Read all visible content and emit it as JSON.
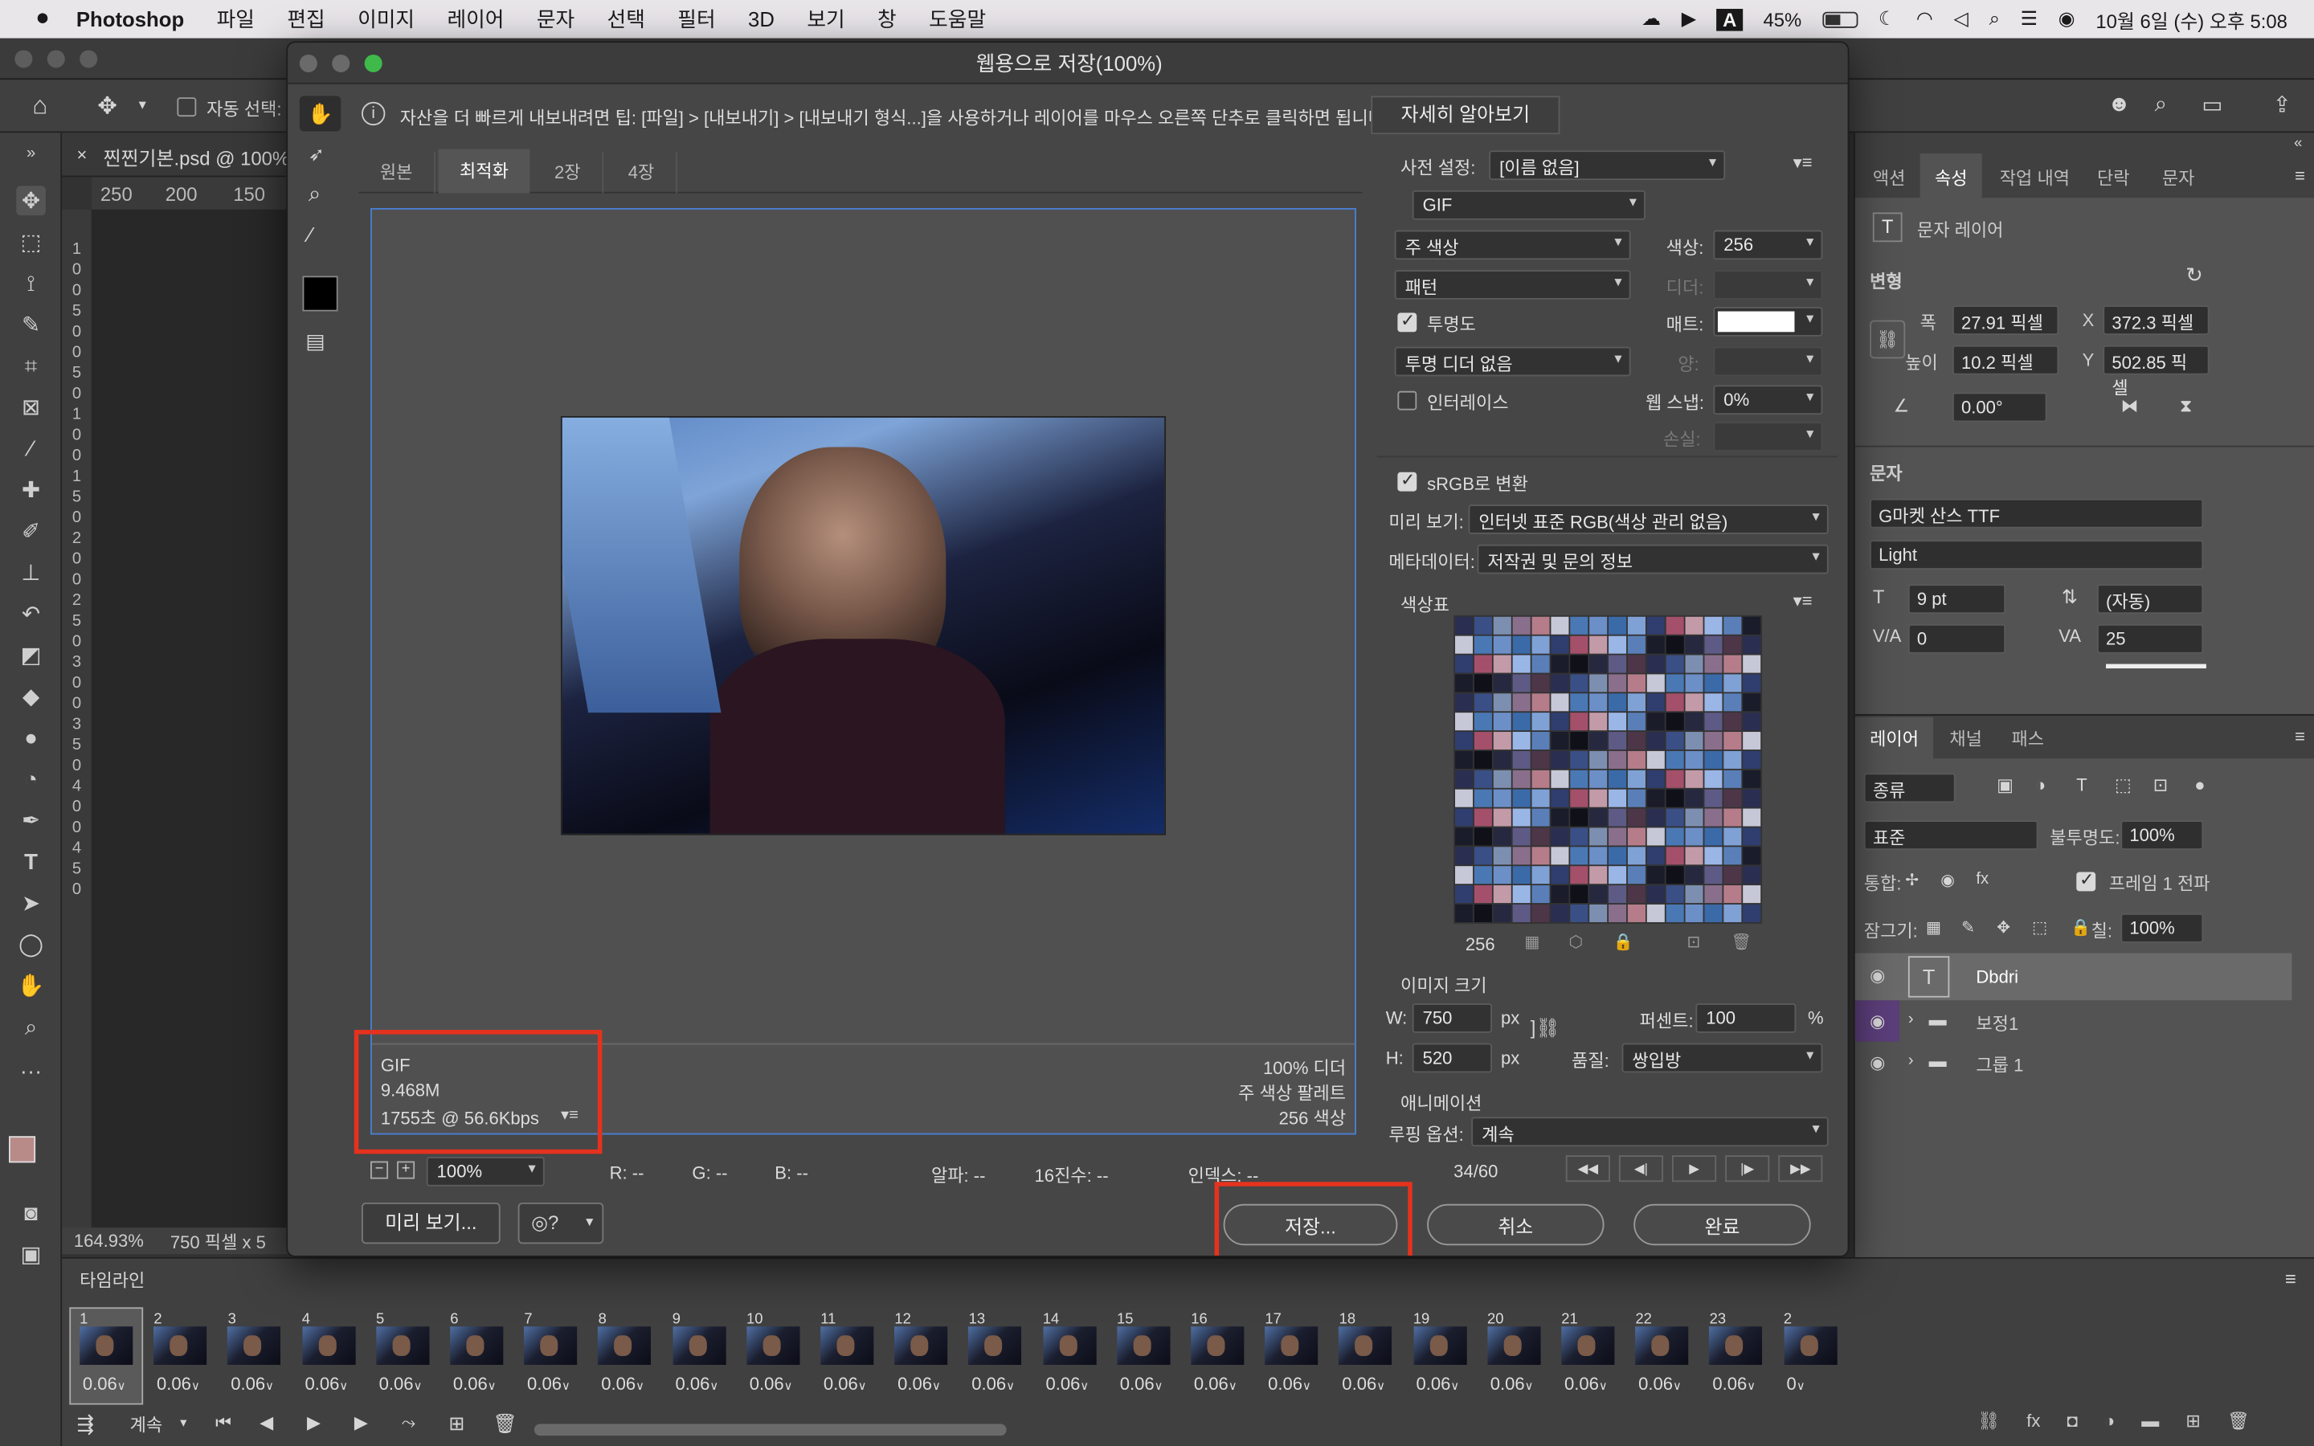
{
  "menubar": {
    "app_name": "Photoshop",
    "menus": [
      "파일",
      "편집",
      "이미지",
      "레이어",
      "문자",
      "선택",
      "필터",
      "3D",
      "보기",
      "창",
      "도움말"
    ],
    "battery": "45%",
    "datetime": "10월 6일 (수) 오후 5:08",
    "input_source": "A"
  },
  "optbar": {
    "auto_select_label": "자동 선택:"
  },
  "document": {
    "tab_title": "찐찐기본.psd @ 100%",
    "ruler_ticks": [
      "250",
      "200",
      "150"
    ],
    "ruler_v": "1 0 0 5 0 0 5 0 1 0 0 1 5 0 2 0 0 2 5 0 3 0 0 3 5 0 4 0 0 4 5 0",
    "zoom": "164.93%",
    "size_info": "750 픽셀 x 5"
  },
  "timeline": {
    "title": "타임라인",
    "frames": [
      {
        "n": "1",
        "d": "0.06"
      },
      {
        "n": "2",
        "d": "0.06"
      },
      {
        "n": "3",
        "d": "0.06"
      },
      {
        "n": "4",
        "d": "0.06"
      },
      {
        "n": "5",
        "d": "0.06"
      },
      {
        "n": "6",
        "d": "0.06"
      },
      {
        "n": "7",
        "d": "0.06"
      },
      {
        "n": "8",
        "d": "0.06"
      },
      {
        "n": "9",
        "d": "0.06"
      },
      {
        "n": "10",
        "d": "0.06"
      },
      {
        "n": "11",
        "d": "0.06"
      },
      {
        "n": "12",
        "d": "0.06"
      },
      {
        "n": "13",
        "d": "0.06"
      },
      {
        "n": "14",
        "d": "0.06"
      },
      {
        "n": "15",
        "d": "0.06"
      },
      {
        "n": "16",
        "d": "0.06"
      },
      {
        "n": "17",
        "d": "0.06"
      },
      {
        "n": "18",
        "d": "0.06"
      },
      {
        "n": "19",
        "d": "0.06"
      },
      {
        "n": "20",
        "d": "0.06"
      },
      {
        "n": "21",
        "d": "0.06"
      },
      {
        "n": "22",
        "d": "0.06"
      },
      {
        "n": "23",
        "d": "0.06"
      },
      {
        "n": "2",
        "d": "0"
      }
    ],
    "loop_label": "계속"
  },
  "properties": {
    "tabs": [
      "액션",
      "속성",
      "작업 내역",
      "단락",
      "문자"
    ],
    "layer_kind": "문자 레이어",
    "transform_title": "변형",
    "w_label": "폭",
    "w": "27.91 픽셀",
    "x_label": "X",
    "x": "372.3 픽셀",
    "h_label": "높이",
    "h": "10.2 픽셀",
    "y_label": "Y",
    "y": "502.85 픽셀",
    "angle": "0.00°",
    "char_title": "문자",
    "font": "G마켓 산스 TTF",
    "style": "Light",
    "size": "9 pt",
    "leading": "(자동)",
    "kerning": "0",
    "tracking": "25"
  },
  "layers": {
    "tabs": [
      "레이어",
      "채널",
      "패스"
    ],
    "filter": "종류",
    "blend": "표준",
    "opacity_label": "불투명도:",
    "opacity": "100%",
    "unify_label": "통합:",
    "propagate_label": "프레임 1 전파",
    "lock_label": "잠그기:",
    "fill_label": "칠:",
    "fill": "100%",
    "items": [
      {
        "name": "Dbdri",
        "type": "text",
        "color": "#4a4a4a"
      },
      {
        "name": "보정1",
        "type": "group",
        "color": "#5b3e7a"
      },
      {
        "name": "그룹 1",
        "type": "group",
        "color": "#3f3f3f"
      }
    ]
  },
  "dialog": {
    "title": "웹용으로 저장(100%)",
    "tip": "자산을 더 빠르게 내보내려면 팁: [파일] > [내보내기] > [내보내기 형식...]을 사용하거나 레이어를 마우스 오른쪽 단추로 클릭하면 됩니다.",
    "learn_more": "자세히 알아보기",
    "view_tabs": [
      "원본",
      "최적화",
      "2장",
      "4장"
    ],
    "active_tab": "최적화",
    "preview_info": {
      "format": "GIF",
      "size": "9.468M",
      "time": "1755초 @ 56.6Kbps",
      "dither_pct": "100% 디더",
      "palette": "주 색상 팔레트",
      "colors": "256 색상"
    },
    "zoom": "100%",
    "readouts": {
      "r": "R: --",
      "g": "G: --",
      "b": "B: --",
      "alpha": "알파: --",
      "hex": "16진수: --",
      "index": "인덱스: --"
    },
    "preview_button": "미리 보기...",
    "save_button": "저장...",
    "cancel_button": "취소",
    "done_button": "완료",
    "settings": {
      "preset_label": "사전 설정:",
      "preset": "[이름 없음]",
      "format": "GIF",
      "reduction": "주 색상",
      "colors_label": "색상:",
      "colors": "256",
      "dither_algo": "패턴",
      "dither_label": "디더:",
      "transparency_label": "투명도",
      "matte_label": "매트:",
      "trans_dither": "투명 디더 없음",
      "amount_label": "양:",
      "interlace_label": "인터레이스",
      "websnap_label": "웹 스냅:",
      "websnap": "0%",
      "lossy_label": "손실:",
      "srgb_label": "sRGB로 변환",
      "preview_label": "미리 보기:",
      "preview_value": "인터넷 표준 RGB(색상 관리 없음)",
      "metadata_label": "메타데이터:",
      "metadata_value": "저작권 및 문의 정보",
      "color_table_label": "색상표",
      "color_count": "256",
      "image_size_label": "이미지 크기",
      "w_label": "W:",
      "w": "750",
      "px": "px",
      "h_label": "H:",
      "h": "520",
      "percent_label": "퍼센트:",
      "percent": "100",
      "pct_unit": "%",
      "quality_label": "품질:",
      "quality": "쌍입방",
      "animation_label": "애니메이션",
      "loop_label": "루핑 옵션:",
      "loop_value": "계속",
      "frame_counter": "34/60"
    }
  },
  "colors": {
    "highlight": "#e5321e",
    "accent": "#4a7fd4"
  }
}
